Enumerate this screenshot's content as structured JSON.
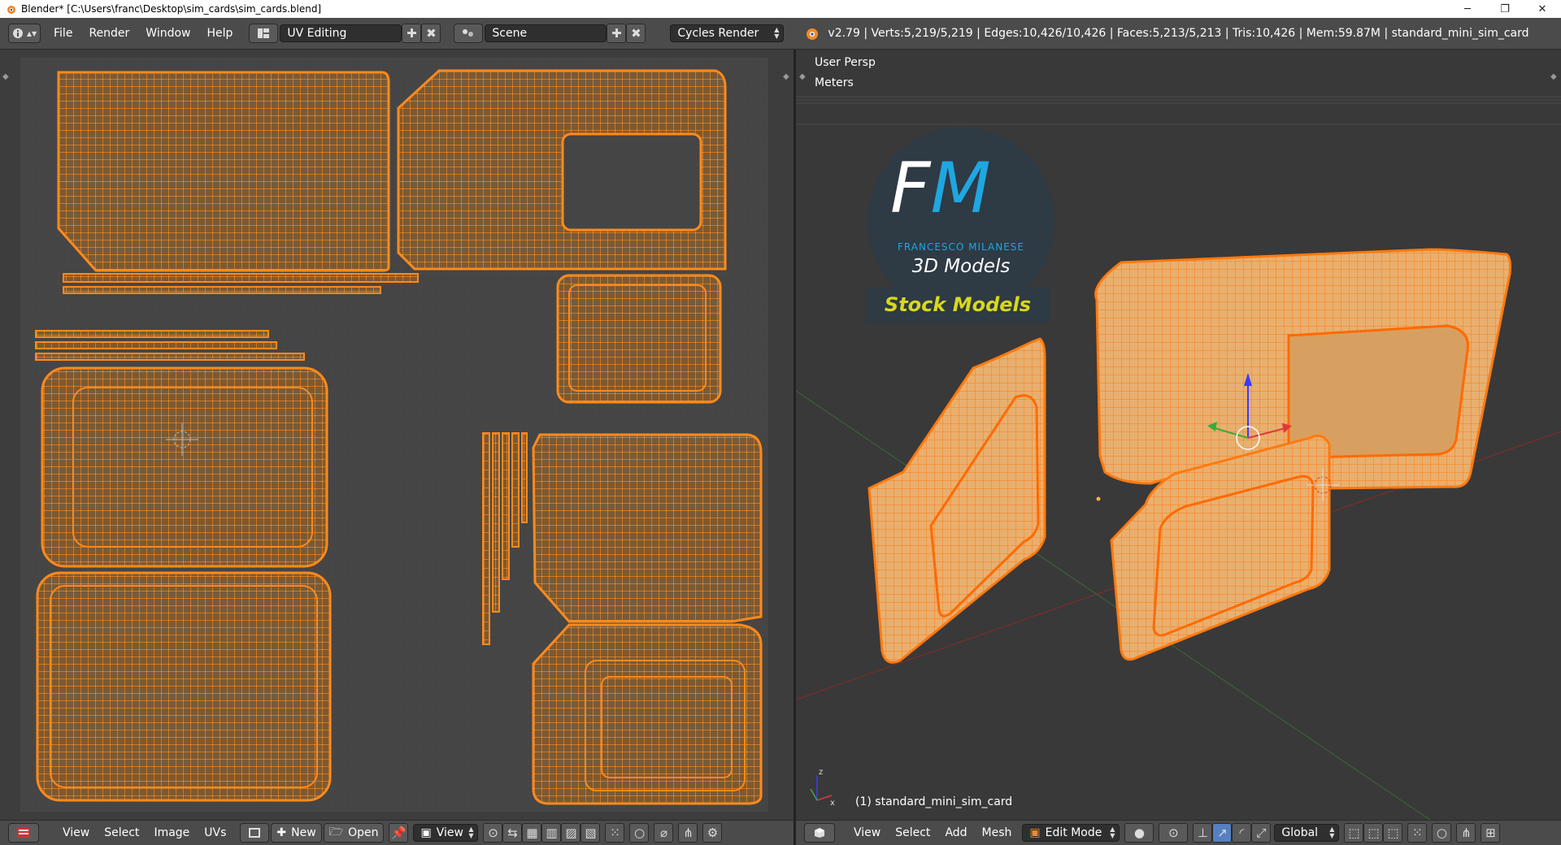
{
  "window": {
    "title": "Blender* [C:\\Users\\franc\\Desktop\\sim_cards\\sim_cards.blend]",
    "minimize": "─",
    "maximize": "❐",
    "close": "✕"
  },
  "header": {
    "menus": [
      "File",
      "Render",
      "Window",
      "Help"
    ],
    "screen_layout": "UV Editing",
    "scene": "Scene",
    "render_engine": "Cycles Render",
    "stats": "v2.79 | Verts:5,219/5,219 | Edges:10,426/10,426 | Faces:5,213/5,213 | Tris:10,426 | Mem:59.87M | standard_mini_sim_card"
  },
  "viewport": {
    "view_name": "User Persp",
    "units": "Meters",
    "object_label": "(1) standard_mini_sim_card"
  },
  "watermark": {
    "initials_f": "F",
    "initials_m": "M",
    "name": "FRANCESCO MILANESE",
    "subtitle": "3D Models",
    "banner": "Stock Models",
    "colors": {
      "circle": "#2e3a44",
      "blue": "#1ea7e1",
      "yellow": "#d8d81e"
    }
  },
  "uv_footer": {
    "menus": [
      "View",
      "Select",
      "Image",
      "UVs"
    ],
    "new_button": "New",
    "open_button": "Open",
    "view_dropdown": "View"
  },
  "view3d_footer": {
    "menus": [
      "View",
      "Select",
      "Add",
      "Mesh"
    ],
    "mode": "Edit Mode",
    "orientation": "Global"
  },
  "colors": {
    "uv_wire": "#ff8a1c",
    "uv_fill": "#7a5a35",
    "mesh_fill": "#e8b070",
    "accent_blue": "#5680c2"
  }
}
